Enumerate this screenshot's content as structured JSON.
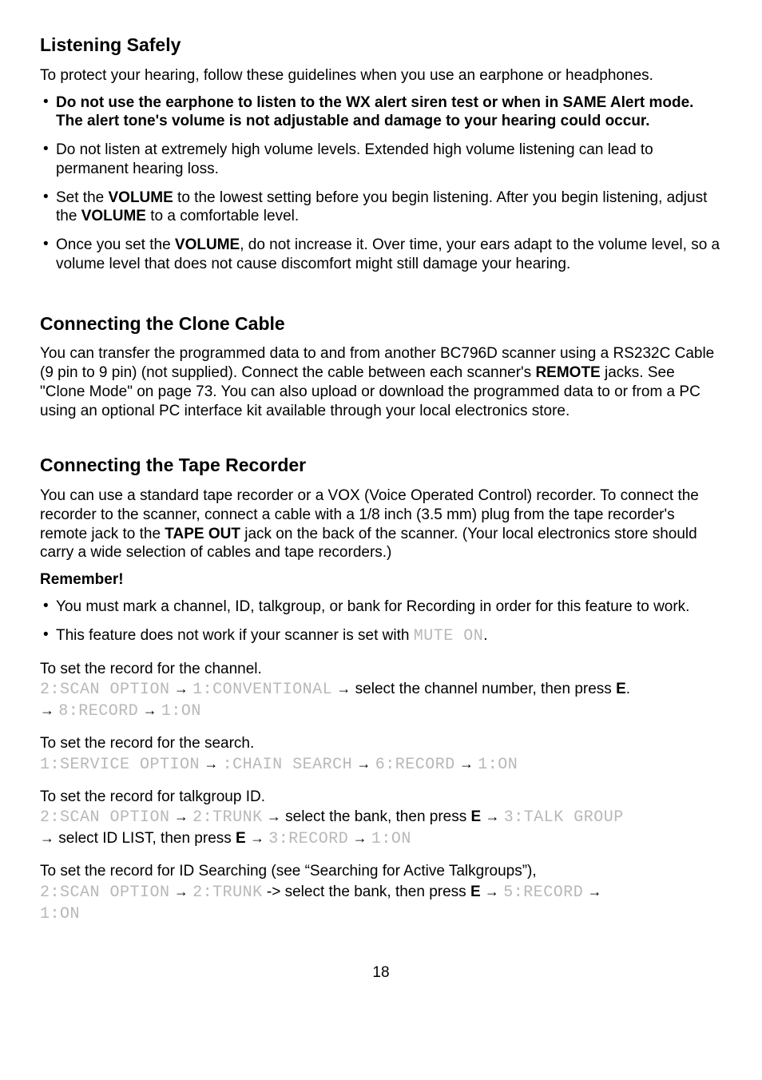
{
  "h_listening": "Listening Safely",
  "p_listening_intro": "To protect your hearing, follow these guidelines when you use an earphone or headphones.",
  "li1_bold": "Do not use the earphone to listen to the WX alert siren test or when in SAME Alert mode. The alert tone's volume is not adjustable and damage to your hearing could occur.",
  "li2": "Do not listen at extremely high volume levels. Extended high volume listening can lead to permanent hearing loss.",
  "li3_a": "Set the ",
  "li3_vol1": "VOLUME",
  "li3_b": " to the lowest setting before you begin listening. After you begin listening, adjust the ",
  "li3_vol2": "VOLUME",
  "li3_c": " to a comfortable level.",
  "li4_a": "Once you set the ",
  "li4_vol": "VOLUME",
  "li4_b": ", do not increase it. Over time, your ears adapt to the volume level, so a volume level that does not cause discomfort might still damage your hearing.",
  "h_clone": "Connecting the Clone Cable",
  "p_clone_a": "You can transfer the programmed data to and from another BC796D scanner using a RS232C Cable (9 pin to 9 pin) (not supplied). Connect the cable between each scanner's ",
  "p_clone_remote": "REMOTE",
  "p_clone_b": " jacks. See \"Clone Mode\" on page 73. You can also upload or download the programmed data to or from a PC using an optional PC interface kit available through your local electronics store.",
  "h_tape": "Connecting the Tape Recorder",
  "p_tape_a": "You can use a standard tape recorder or a VOX (Voice Operated Control) recorder. To connect the recorder to the scanner, connect a cable with a 1/8 inch (3.5 mm) plug from the tape recorder's remote jack to the ",
  "p_tape_out": "TAPE OUT",
  "p_tape_b": " jack on the back of the scanner. (Your local electronics store should carry a wide selection of cables and tape recorders.)",
  "remember": "Remember!",
  "rem_li1": "You must mark a channel, ID, talkgroup, or bank for Recording in order for this feature to work.",
  "rem_li2_a": "This feature does not work if your scanner is set with ",
  "rem_li2_lcd": "MUTE ON",
  "rem_li2_b": ".",
  "proc1_title": "To set the record for the channel.",
  "proc1_s1": "2:SCAN OPTION",
  "proc1_s2": "1:CONVENTIONAL",
  "proc1_mid": " select the channel number, then press ",
  "proc1_e": "E",
  "proc1_dot": ". ",
  "proc1_s3": "8:RECORD",
  "proc1_s4": "1:ON",
  "proc2_title": "To set the record for the search.",
  "proc2_s1": "1:SERVICE OPTION",
  "proc2_s2": ":CHAIN SEARCH",
  "proc2_s3": "6:RECORD",
  "proc2_s4": "1:ON",
  "proc3_title": "To set the record for talkgroup ID.",
  "proc3_s1": "2:SCAN OPTION",
  "proc3_s2": "2:TRUNK",
  "proc3_mid1": " select the bank, then press ",
  "proc3_e1": "E",
  "proc3_s3": "3:TALK GROUP",
  "proc3_mid2": " select ID LIST, then press ",
  "proc3_e2": "E",
  "proc3_s4": "3:RECORD",
  "proc3_s5": "1:ON",
  "proc4_title": "To set the record for ID Searching (see “Searching for Active Talkgroups”),",
  "proc4_s1": "2:SCAN OPTION",
  "proc4_s2": "2:TRUNK",
  "proc4_mid": " -> select the bank, then press ",
  "proc4_e": "E",
  "proc4_s3": "5:RECORD",
  "proc4_s4": "1:ON",
  "arrow": "→",
  "sp": " ",
  "pagenum": "18"
}
